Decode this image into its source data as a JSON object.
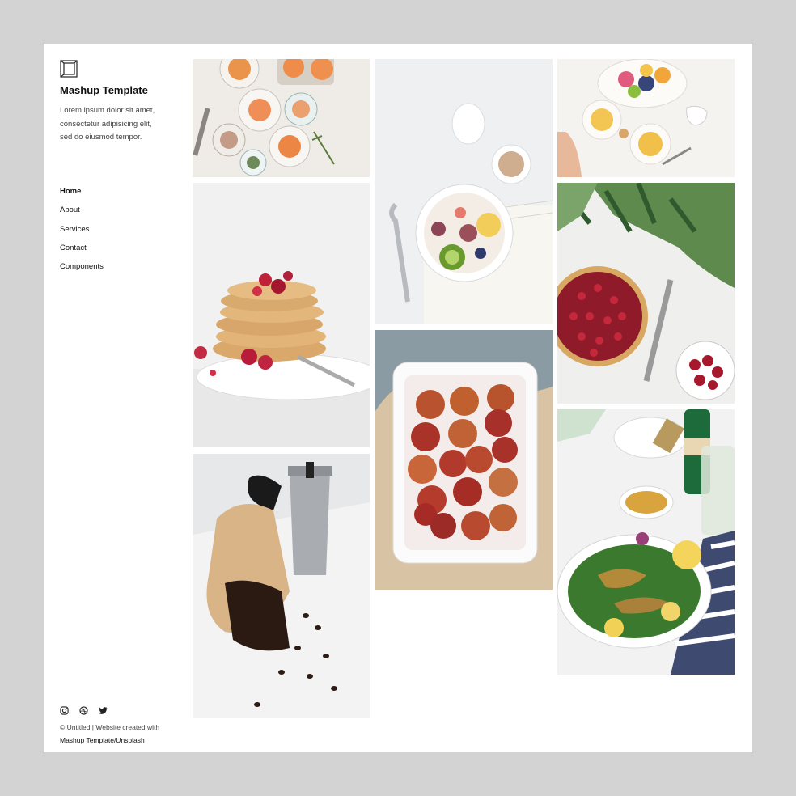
{
  "site": {
    "title": "Mashup Template",
    "tagline_lines": [
      "Lorem ipsum dolor sit amet,",
      "consectetur adipisicing elit,",
      "sed do eiusmod tempor."
    ]
  },
  "nav": {
    "items": [
      {
        "label": "Home",
        "active": true
      },
      {
        "label": "About",
        "active": false
      },
      {
        "label": "Services",
        "active": false
      },
      {
        "label": "Contact",
        "active": false
      },
      {
        "label": "Components",
        "active": false
      }
    ]
  },
  "social": {
    "icons": [
      "instagram-icon",
      "dribbble-icon",
      "twitter-icon"
    ]
  },
  "footer": {
    "copyright": "© Untitled | Website created with",
    "credit": "Mashup Template/Unsplash"
  },
  "colors": {
    "page_background": "#d3d3d3",
    "content_background": "#ffffff"
  }
}
